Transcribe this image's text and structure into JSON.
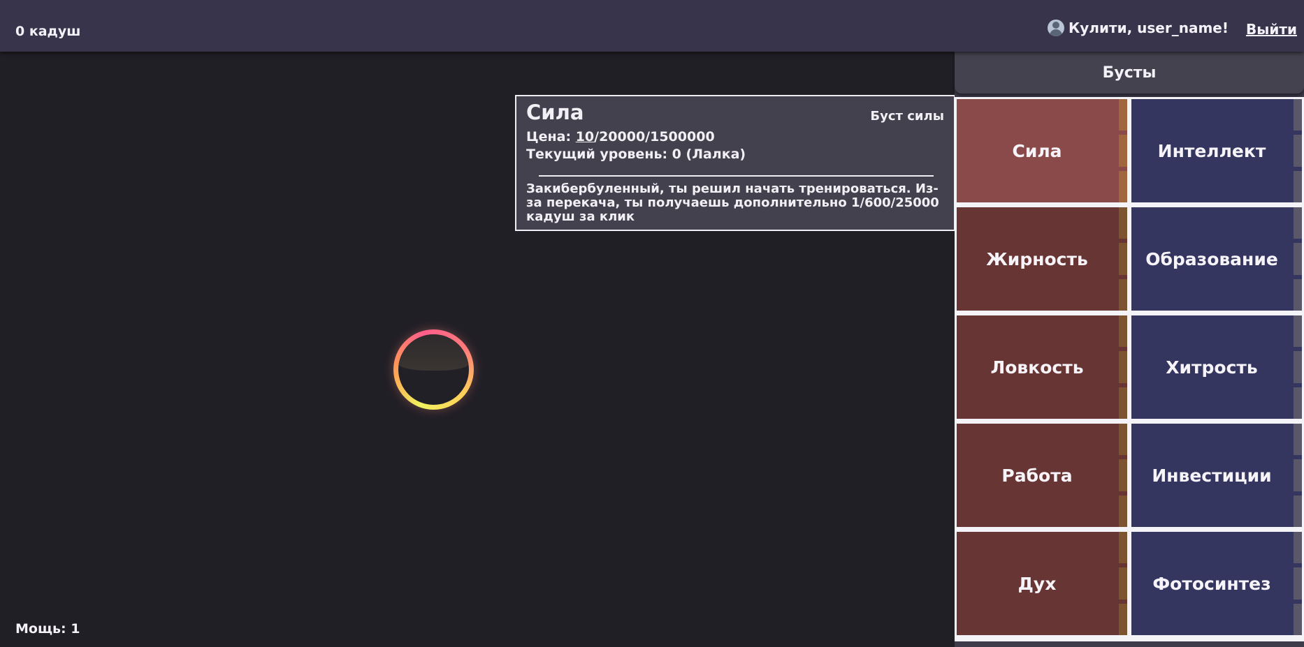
{
  "header": {
    "balance": "0 кадуш",
    "greeting": "Кулити, user_name!",
    "logout": "Выйти"
  },
  "status": {
    "power": "Мощь: 1"
  },
  "tooltip": {
    "title": "Сила",
    "type": "Буст силы",
    "price_label": "Цена: ",
    "price_current": "10",
    "price_rest": "/20000/1500000",
    "level": "Текущий уровень: 0 (Лалка)",
    "description": "Закибербуленный, ты решил начать тренироваться. Из-за перекача, ты получаешь дополнительно 1/600/25000 кадуш за клик"
  },
  "boosts": {
    "title": "Бусты",
    "items": [
      {
        "label": "Сила",
        "bg": "#8b4a4a",
        "pip": "#a0663e"
      },
      {
        "label": "Интеллект",
        "bg": "#343660",
        "pip": "#5a5868"
      },
      {
        "label": "Жирность",
        "bg": "#683535",
        "pip": "#7d5430"
      },
      {
        "label": "Образование",
        "bg": "#343660",
        "pip": "#5a5868"
      },
      {
        "label": "Ловкость",
        "bg": "#683535",
        "pip": "#7d5430"
      },
      {
        "label": "Хитрость",
        "bg": "#343660",
        "pip": "#5a5868"
      },
      {
        "label": "Работа",
        "bg": "#683535",
        "pip": "#7d5430"
      },
      {
        "label": "Инвестиции",
        "bg": "#343660",
        "pip": "#5a5868"
      },
      {
        "label": "Дух",
        "bg": "#683535",
        "pip": "#7d5430"
      },
      {
        "label": "Фотосинтез",
        "bg": "#343660",
        "pip": "#5a5868"
      }
    ]
  }
}
